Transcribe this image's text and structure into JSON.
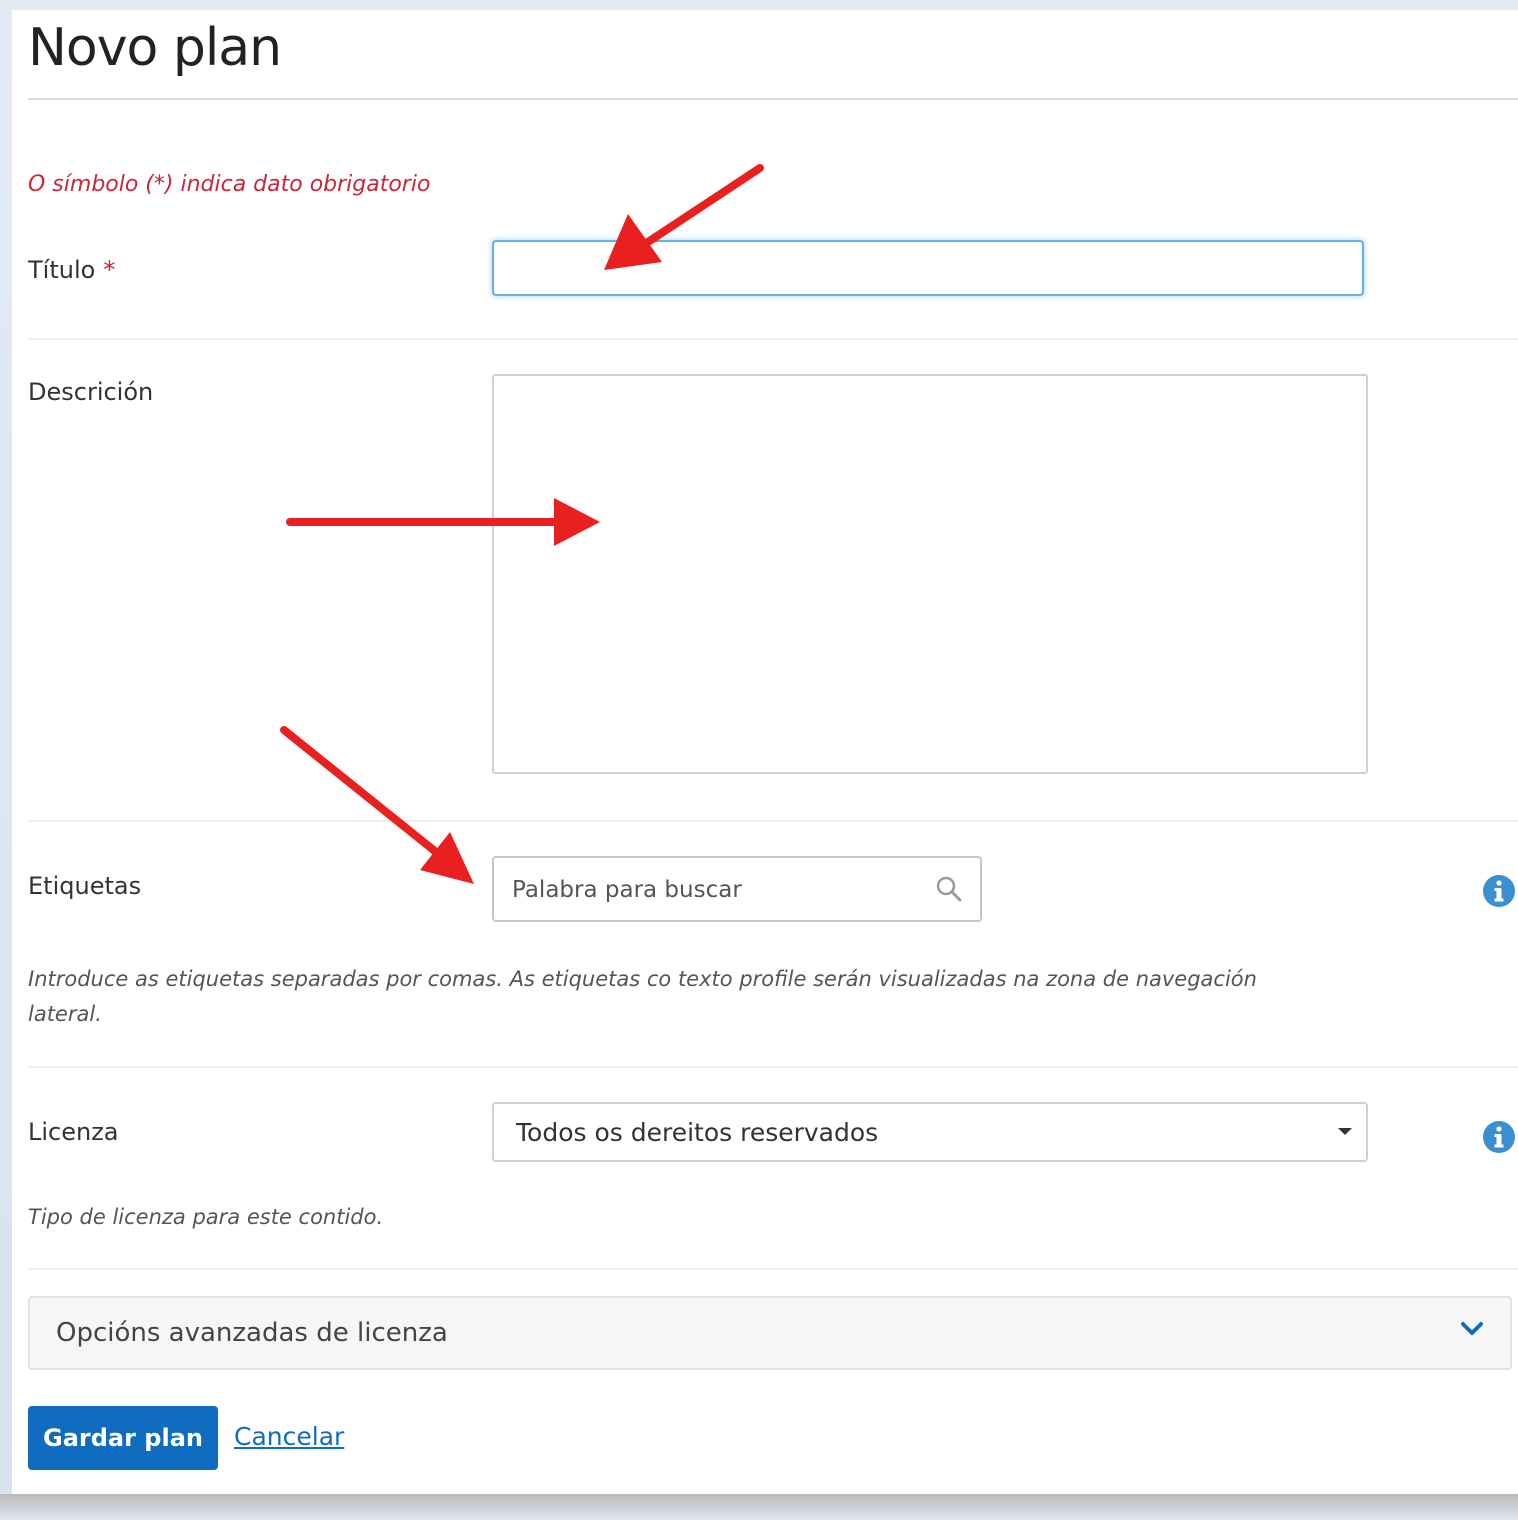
{
  "page": {
    "title": "Novo plan",
    "required_note": "O símbolo (*) indica dato obrigatorio"
  },
  "form": {
    "title_field": {
      "label": "Título",
      "required_mark": "*",
      "value": ""
    },
    "description_field": {
      "label": "Descrición",
      "value": ""
    },
    "tags_field": {
      "label": "Etiquetas",
      "placeholder": "Palabra para buscar",
      "help_line1": "Introduce as etiquetas separadas por comas. As etiquetas co texto profile serán visualizadas na zona de navegación",
      "help_line2": "lateral."
    },
    "license_field": {
      "label": "Licenza",
      "selected": "Todos os dereitos reservados",
      "help": "Tipo de licenza para este contido."
    },
    "advanced_panel": {
      "label": "Opcións avanzadas de licenza"
    }
  },
  "actions": {
    "save_label": "Gardar plan",
    "cancel_label": "Cancelar"
  },
  "colors": {
    "accent": "#0f6cbf",
    "required": "#c9273a",
    "info_icon": "#3a8fd1",
    "annotation_arrow": "#e8201f"
  },
  "icons": [
    "search-icon",
    "info-icon",
    "caret-down-icon",
    "chevron-down-icon",
    "annotation-arrow"
  ]
}
